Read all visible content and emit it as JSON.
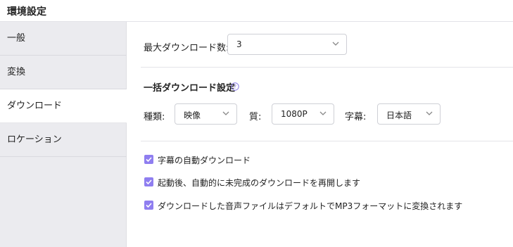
{
  "header": {
    "title": "環境設定"
  },
  "sidebar": {
    "items": [
      {
        "label": "一般"
      },
      {
        "label": "変換"
      },
      {
        "label": "ダウンロード"
      },
      {
        "label": "ロケーション"
      }
    ],
    "active_index": 2
  },
  "main": {
    "max_downloads": {
      "label": "最大ダウンロード数:",
      "value": "3"
    },
    "batch": {
      "title": "一括ダウンロード設定",
      "help_icon": "question-circle-icon",
      "type": {
        "label": "種類:",
        "value": "映像"
      },
      "quality": {
        "label": "質:",
        "value": "1080P"
      },
      "subtitle": {
        "label": "字幕:",
        "value": "日本語"
      }
    },
    "options": [
      {
        "label": "字幕の自動ダウンロード",
        "checked": true
      },
      {
        "label": "起動後、自動的に未完成のダウンロードを再開します",
        "checked": true
      },
      {
        "label": "ダウンロードした音声ファイルはデフォルトでMP3フォーマットに変換されます",
        "checked": true
      }
    ]
  },
  "colors": {
    "accent": "#8f7ef0",
    "sidebar_bg": "#ebebef",
    "help_icon": "#8a7be8"
  }
}
